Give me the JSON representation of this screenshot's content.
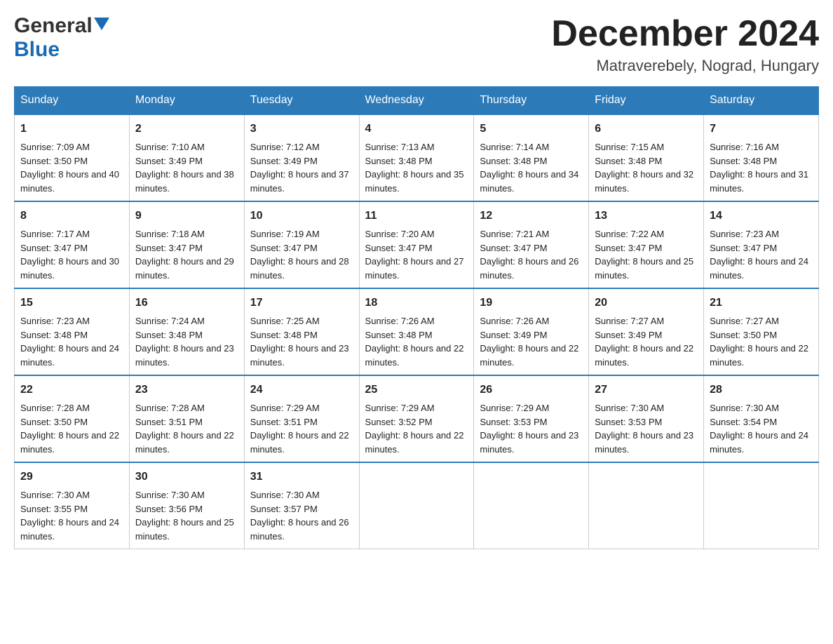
{
  "logo": {
    "line1": "General",
    "line2": "Blue"
  },
  "title": "December 2024",
  "location": "Matraverebely, Nograd, Hungary",
  "days_of_week": [
    "Sunday",
    "Monday",
    "Tuesday",
    "Wednesday",
    "Thursday",
    "Friday",
    "Saturday"
  ],
  "weeks": [
    [
      {
        "day": "1",
        "sunrise": "7:09 AM",
        "sunset": "3:50 PM",
        "daylight": "8 hours and 40 minutes."
      },
      {
        "day": "2",
        "sunrise": "7:10 AM",
        "sunset": "3:49 PM",
        "daylight": "8 hours and 38 minutes."
      },
      {
        "day": "3",
        "sunrise": "7:12 AM",
        "sunset": "3:49 PM",
        "daylight": "8 hours and 37 minutes."
      },
      {
        "day": "4",
        "sunrise": "7:13 AM",
        "sunset": "3:48 PM",
        "daylight": "8 hours and 35 minutes."
      },
      {
        "day": "5",
        "sunrise": "7:14 AM",
        "sunset": "3:48 PM",
        "daylight": "8 hours and 34 minutes."
      },
      {
        "day": "6",
        "sunrise": "7:15 AM",
        "sunset": "3:48 PM",
        "daylight": "8 hours and 32 minutes."
      },
      {
        "day": "7",
        "sunrise": "7:16 AM",
        "sunset": "3:48 PM",
        "daylight": "8 hours and 31 minutes."
      }
    ],
    [
      {
        "day": "8",
        "sunrise": "7:17 AM",
        "sunset": "3:47 PM",
        "daylight": "8 hours and 30 minutes."
      },
      {
        "day": "9",
        "sunrise": "7:18 AM",
        "sunset": "3:47 PM",
        "daylight": "8 hours and 29 minutes."
      },
      {
        "day": "10",
        "sunrise": "7:19 AM",
        "sunset": "3:47 PM",
        "daylight": "8 hours and 28 minutes."
      },
      {
        "day": "11",
        "sunrise": "7:20 AM",
        "sunset": "3:47 PM",
        "daylight": "8 hours and 27 minutes."
      },
      {
        "day": "12",
        "sunrise": "7:21 AM",
        "sunset": "3:47 PM",
        "daylight": "8 hours and 26 minutes."
      },
      {
        "day": "13",
        "sunrise": "7:22 AM",
        "sunset": "3:47 PM",
        "daylight": "8 hours and 25 minutes."
      },
      {
        "day": "14",
        "sunrise": "7:23 AM",
        "sunset": "3:47 PM",
        "daylight": "8 hours and 24 minutes."
      }
    ],
    [
      {
        "day": "15",
        "sunrise": "7:23 AM",
        "sunset": "3:48 PM",
        "daylight": "8 hours and 24 minutes."
      },
      {
        "day": "16",
        "sunrise": "7:24 AM",
        "sunset": "3:48 PM",
        "daylight": "8 hours and 23 minutes."
      },
      {
        "day": "17",
        "sunrise": "7:25 AM",
        "sunset": "3:48 PM",
        "daylight": "8 hours and 23 minutes."
      },
      {
        "day": "18",
        "sunrise": "7:26 AM",
        "sunset": "3:48 PM",
        "daylight": "8 hours and 22 minutes."
      },
      {
        "day": "19",
        "sunrise": "7:26 AM",
        "sunset": "3:49 PM",
        "daylight": "8 hours and 22 minutes."
      },
      {
        "day": "20",
        "sunrise": "7:27 AM",
        "sunset": "3:49 PM",
        "daylight": "8 hours and 22 minutes."
      },
      {
        "day": "21",
        "sunrise": "7:27 AM",
        "sunset": "3:50 PM",
        "daylight": "8 hours and 22 minutes."
      }
    ],
    [
      {
        "day": "22",
        "sunrise": "7:28 AM",
        "sunset": "3:50 PM",
        "daylight": "8 hours and 22 minutes."
      },
      {
        "day": "23",
        "sunrise": "7:28 AM",
        "sunset": "3:51 PM",
        "daylight": "8 hours and 22 minutes."
      },
      {
        "day": "24",
        "sunrise": "7:29 AM",
        "sunset": "3:51 PM",
        "daylight": "8 hours and 22 minutes."
      },
      {
        "day": "25",
        "sunrise": "7:29 AM",
        "sunset": "3:52 PM",
        "daylight": "8 hours and 22 minutes."
      },
      {
        "day": "26",
        "sunrise": "7:29 AM",
        "sunset": "3:53 PM",
        "daylight": "8 hours and 23 minutes."
      },
      {
        "day": "27",
        "sunrise": "7:30 AM",
        "sunset": "3:53 PM",
        "daylight": "8 hours and 23 minutes."
      },
      {
        "day": "28",
        "sunrise": "7:30 AM",
        "sunset": "3:54 PM",
        "daylight": "8 hours and 24 minutes."
      }
    ],
    [
      {
        "day": "29",
        "sunrise": "7:30 AM",
        "sunset": "3:55 PM",
        "daylight": "8 hours and 24 minutes."
      },
      {
        "day": "30",
        "sunrise": "7:30 AM",
        "sunset": "3:56 PM",
        "daylight": "8 hours and 25 minutes."
      },
      {
        "day": "31",
        "sunrise": "7:30 AM",
        "sunset": "3:57 PM",
        "daylight": "8 hours and 26 minutes."
      },
      null,
      null,
      null,
      null
    ]
  ],
  "labels": {
    "sunrise": "Sunrise:",
    "sunset": "Sunset:",
    "daylight": "Daylight:"
  }
}
